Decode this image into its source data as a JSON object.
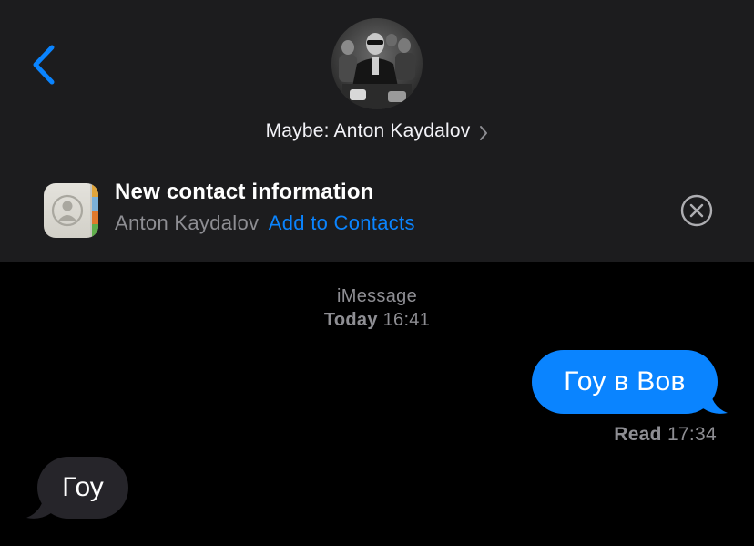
{
  "colors": {
    "accent": "#0a84ff",
    "header_bg": "#1c1c1e",
    "background": "#000000",
    "incoming_bubble": "#26252a",
    "secondary_text": "#8e8e93"
  },
  "header": {
    "back_icon": "chevron-left-icon",
    "avatar_icon": "contact-photo",
    "contact_name": "Maybe: Anton Kaydalov",
    "name_chevron_icon": "chevron-right-icon"
  },
  "banner": {
    "icon": "contacts-app-icon",
    "title": "New contact information",
    "name": "Anton Kaydalov",
    "action": "Add to Contacts",
    "dismiss_icon": "close-circle-icon"
  },
  "conversation": {
    "service": "iMessage",
    "date_day": "Today",
    "date_time": "16:41",
    "messages": [
      {
        "direction": "outgoing",
        "text": "Гоу в Вов"
      },
      {
        "direction": "incoming",
        "text": "Гоу"
      }
    ],
    "receipt_label": "Read",
    "receipt_time": "17:34"
  }
}
